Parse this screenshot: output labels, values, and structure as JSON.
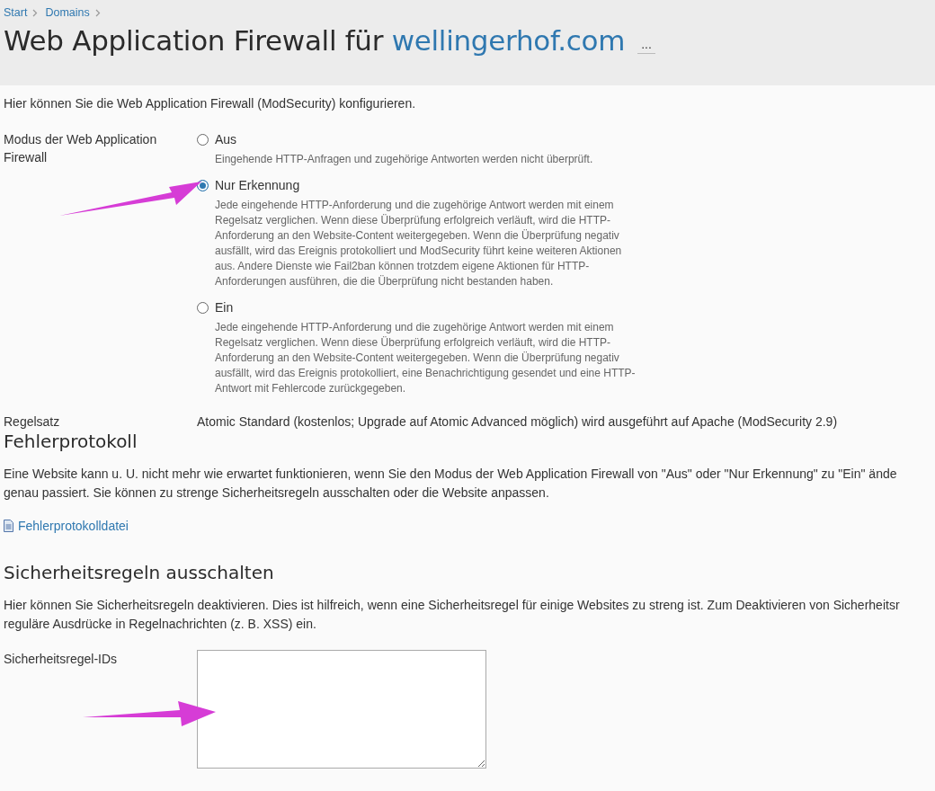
{
  "breadcrumb": [
    "Start",
    "Domains"
  ],
  "title": {
    "text": "Web Application Firewall für",
    "domain": "wellingerhof.com",
    "more": "..."
  },
  "intro": "Hier können Sie die Web Application Firewall (ModSecurity) konfigurieren.",
  "mode": {
    "label": "Modus der Web Application Firewall",
    "options": [
      {
        "label": "Aus",
        "selected": false,
        "description": "Eingehende HTTP-Anfragen und zugehörige Antworten werden nicht überprüft."
      },
      {
        "label": "Nur Erkennung",
        "selected": true,
        "description": "Jede eingehende HTTP-Anforderung und die zugehörige Antwort werden mit einem Regelsatz verglichen. Wenn diese Überprüfung erfolgreich verläuft, wird die HTTP-Anforderung an den Website-Content weitergegeben. Wenn die Überprüfung negativ ausfällt, wird das Ereignis protokolliert und ModSecurity führt keine weiteren Aktionen aus. Andere Dienste wie Fail2ban können trotzdem eigene Aktionen für HTTP-Anforderungen ausführen, die die Überprüfung nicht bestanden haben."
      },
      {
        "label": "Ein",
        "selected": false,
        "description": "Jede eingehende HTTP-Anforderung und die zugehörige Antwort werden mit einem Regelsatz verglichen. Wenn diese Überprüfung erfolgreich verläuft, wird die HTTP-Anforderung an den Website-Content weitergegeben. Wenn die Überprüfung negativ ausfällt, wird das Ereignis protokolliert, eine Benachrichtigung gesendet und eine HTTP-Antwort mit Fehlercode zurückgegeben."
      }
    ]
  },
  "ruleset": {
    "label": "Regelsatz",
    "value": "Atomic Standard (kostenlos; Upgrade auf Atomic Advanced möglich) wird ausgeführt auf Apache (ModSecurity 2.9)"
  },
  "error_log": {
    "heading": "Fehlerprotokoll",
    "lines": [
      "Eine Website kann u. U. nicht mehr wie erwartet funktionieren, wenn Sie den Modus der Web Application Firewall von \"Aus\" oder \"Nur Erkennung\" zu \"Ein\" ände",
      "genau passiert. Sie können zu strenge Sicherheitsregeln ausschalten oder die Website anpassen."
    ],
    "link": "Fehlerprotokolldatei"
  },
  "disable_rules": {
    "heading": "Sicherheitsregeln ausschalten",
    "lines": [
      "Hier können Sie Sicherheitsregeln deaktivieren. Dies ist hilfreich, wenn eine Sicherheitsregel für einige Websites zu streng ist. Zum Deaktivieren von Sicherheitsr",
      "reguläre Ausdrücke in Regelnachrichten (z. B. XSS) ein."
    ],
    "field_label": "Sicherheitsregel-IDs"
  }
}
